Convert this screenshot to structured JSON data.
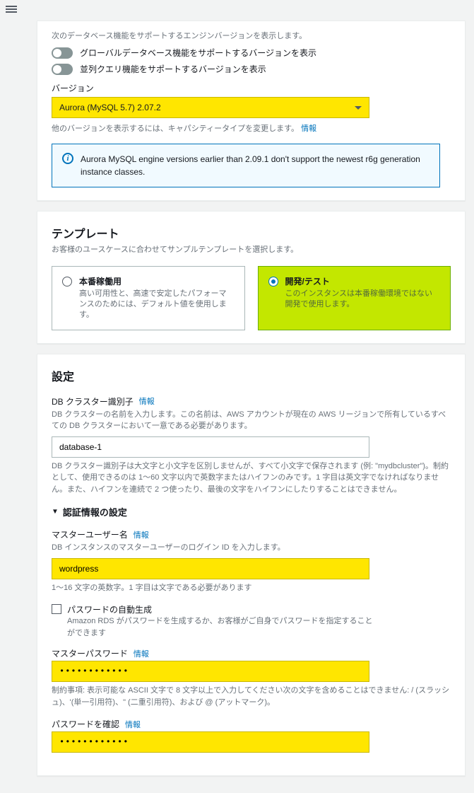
{
  "top": {
    "engine_version_desc": "次のデータベース機能をサポートするエンジンバージョンを表示します。",
    "toggles": {
      "global_db": "グローバルデータベース機能をサポートするバージョンを表示",
      "parallel_query": "並列クエリ機能をサポートするバージョンを表示"
    },
    "version_label": "バージョン",
    "version_value": "Aurora (MySQL 5.7) 2.07.2",
    "version_note": "他のバージョンを表示するには、キャパシティータイプを変更します。",
    "info_link": "情報",
    "info_box_text": "Aurora MySQL engine versions earlier than 2.09.1 don't support the newest r6g generation instance classes."
  },
  "templates": {
    "title": "テンプレート",
    "subtitle": "お客様のユースケースに合わせてサンプルテンプレートを選択します。",
    "production": {
      "title": "本番稼働用",
      "desc": "高い可用性と、高速で安定したパフォーマンスのためには、デフォルト値を使用します。"
    },
    "devtest": {
      "title": "開発/テスト",
      "desc": "このインスタンスは本番稼働環境ではない開発で使用します。"
    }
  },
  "settings": {
    "title": "設定",
    "cluster_id_label": "DB クラスター識別子",
    "cluster_id_desc": "DB クラスターの名前を入力します。この名前は、AWS アカウントが現在の AWS リージョンで所有しているすべての DB クラスターにおいて一意である必要があります。",
    "cluster_id_value": "database-1",
    "cluster_id_hint": "DB クラスター識別子は大文字と小文字を区別しませんが、すべて小文字で保存されます (例: \"mydbcluster\")。制約として、使用できるのは 1〜60 文字以内で英数字またはハイフンのみです。1 字目は英文字でなければなりません。また、ハイフンを連続で 2 つ使ったり、最後の文字をハイフンにしたりすることはできません。",
    "credentials_header": "認証情報の設定",
    "master_user_label": "マスターユーザー名",
    "master_user_desc": "DB インスタンスのマスターユーザーのログイン ID を入力します。",
    "master_user_value": "wordpress",
    "master_user_hint": "1〜16 文字の英数字。1 字目は文字である必要があります",
    "auto_pw_label": "パスワードの自動生成",
    "auto_pw_desc": "Amazon RDS がパスワードを生成するか、お客様がご自身でパスワードを指定することができます",
    "master_pw_label": "マスターパスワード",
    "master_pw_value": "••••••••••••",
    "master_pw_hint": "制約事項: 表示可能な ASCII 文字で 8 文字以上で入力してください次の文字を含めることはできません: / (スラッシュ)、'(単一引用符)、\" (二重引用符)、および @ (アットマーク)。",
    "confirm_pw_label": "パスワードを確認",
    "confirm_pw_value": "••••••••••••",
    "info_link": "情報"
  }
}
